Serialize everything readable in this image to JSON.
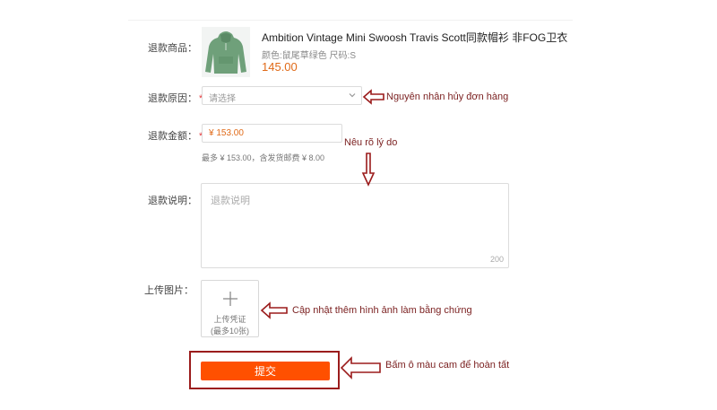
{
  "form": {
    "product_label": "退款商品：",
    "product_title": "Ambition Vintage Mini Swoosh Travis Scott同款帽衫 非FOG卫衣",
    "product_meta": "颜色:鼠尾草绿色   尺码:S",
    "product_price": "145.00",
    "reason_label": "退款原因：",
    "reason_placeholder": "请选择",
    "amount_label": "退款金额：",
    "amount_value": "¥ 153.00",
    "amount_hint": "最多 ¥ 153.00，含发货邮费 ¥ 8.00",
    "desc_label": "退款说明：",
    "desc_placeholder": "退款说明",
    "desc_counter": "200",
    "upload_label": "上传图片：",
    "upload_text": "上传凭证",
    "upload_limit": "(最多10张)",
    "submit_label": "提交",
    "required_mark": "*"
  },
  "annotations": {
    "reason": "Nguyên nhân hủy đơn hàng",
    "detail": "Nêu rõ lý do",
    "upload": "Cập nhật thêm hình ảnh làm bằng chứng",
    "submit": "Bấm ô màu cam để hoàn tất"
  },
  "colors": {
    "accent_orange": "#ff5000",
    "price_orange": "#e06a18",
    "annotation_red": "#9b1c1c",
    "required_red": "#e4393c",
    "hoodie_green": "#6fa07a"
  },
  "icons": {
    "dropdown": "chevron-down-icon",
    "upload": "plus-icon",
    "product_image": "hoodie-photo"
  }
}
